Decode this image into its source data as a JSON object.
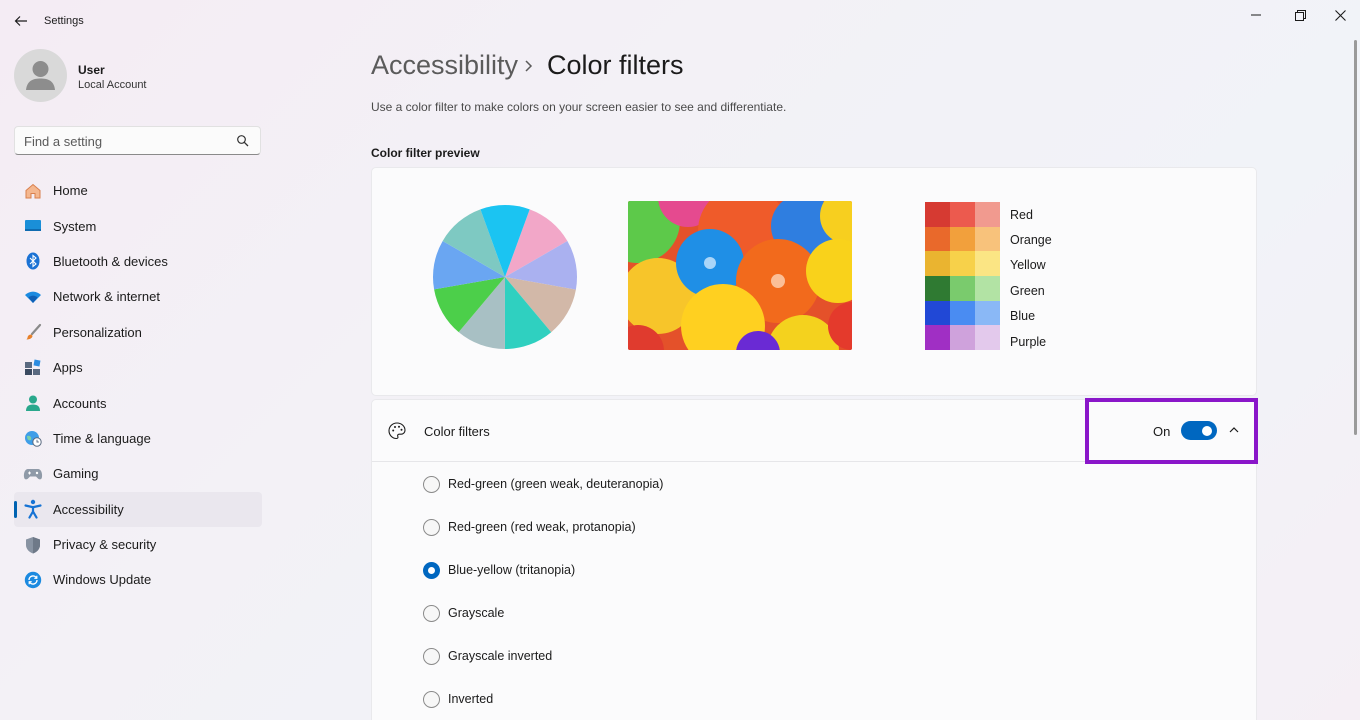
{
  "window": {
    "title": "Settings"
  },
  "user": {
    "name": "User",
    "account_type": "Local Account"
  },
  "search": {
    "placeholder": "Find a setting"
  },
  "sidebar": {
    "items": [
      {
        "label": "Home",
        "icon": "home-icon"
      },
      {
        "label": "System",
        "icon": "system-icon"
      },
      {
        "label": "Bluetooth & devices",
        "icon": "bluetooth-icon"
      },
      {
        "label": "Network & internet",
        "icon": "wifi-icon"
      },
      {
        "label": "Personalization",
        "icon": "brush-icon"
      },
      {
        "label": "Apps",
        "icon": "apps-icon"
      },
      {
        "label": "Accounts",
        "icon": "accounts-icon"
      },
      {
        "label": "Time & language",
        "icon": "globe-clock-icon"
      },
      {
        "label": "Gaming",
        "icon": "gamepad-icon"
      },
      {
        "label": "Accessibility",
        "icon": "accessibility-icon",
        "active": true
      },
      {
        "label": "Privacy & security",
        "icon": "shield-icon"
      },
      {
        "label": "Windows Update",
        "icon": "update-icon"
      }
    ]
  },
  "breadcrumb": {
    "parent": "Accessibility",
    "current": "Color filters"
  },
  "description": "Use a color filter to make colors on your screen easier to see and differentiate.",
  "preview": {
    "title": "Color filter preview",
    "swatch_labels": [
      "Red",
      "Orange",
      "Yellow",
      "Green",
      "Blue",
      "Purple"
    ],
    "swatch_colors": [
      [
        "#d63a32",
        "#ec5a4e",
        "#f19a8f"
      ],
      [
        "#e9692b",
        "#f2a03c",
        "#f8c27b"
      ],
      [
        "#eab430",
        "#f7d14a",
        "#fbe584"
      ],
      [
        "#2f7a32",
        "#7acb6d",
        "#b2e3a4"
      ],
      [
        "#2148d6",
        "#4a8cf2",
        "#8ab8f6"
      ],
      [
        "#a02fc4",
        "#cfa2dc",
        "#e3c9ec"
      ]
    ],
    "pie_colors": [
      "#f2a7c8",
      "#aab1f0",
      "#d2b8a8",
      "#2fd0c0",
      "#a8c0c4",
      "#4ccf4a",
      "#6aa6f2",
      "#7ec9c2",
      "#1bc4f2"
    ]
  },
  "color_filters": {
    "title": "Color filters",
    "toggle_state": "On",
    "enabled": true,
    "options": [
      {
        "label": "Red-green (green weak, deuteranopia)",
        "checked": false
      },
      {
        "label": "Red-green (red weak, protanopia)",
        "checked": false
      },
      {
        "label": "Blue-yellow (tritanopia)",
        "checked": true
      },
      {
        "label": "Grayscale",
        "checked": false
      },
      {
        "label": "Grayscale inverted",
        "checked": false
      },
      {
        "label": "Inverted",
        "checked": false
      }
    ]
  },
  "colors": {
    "accent": "#0067c0",
    "highlight": "#8a16c9"
  }
}
